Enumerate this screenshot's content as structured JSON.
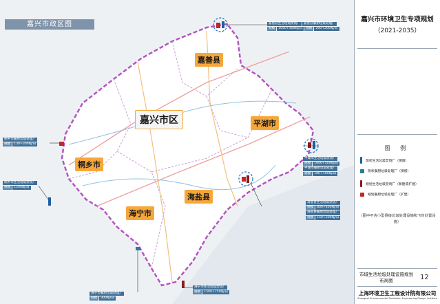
{
  "map": {
    "title": "嘉兴市政区图",
    "districts": [
      {
        "name": "嘉兴市区",
        "style": "big"
      },
      {
        "name": "嘉善县",
        "style": "normal"
      },
      {
        "name": "平湖市",
        "style": "normal"
      },
      {
        "name": "桐乡市",
        "style": "normal"
      },
      {
        "name": "海盐县",
        "style": "normal"
      },
      {
        "name": "海宁市",
        "style": "normal"
      }
    ],
    "callouts": [
      {
        "rows": [
          [
            "嘉善县生活垃圾焚烧厂",
            "嘉善县餐厨垃圾处理厂"
          ],
          [
            "规模",
            "1050+400吨/日",
            "规模",
            "200+200吨/日"
          ]
        ]
      },
      {
        "rows": [
          [
            "桐乡市餐厨垃圾处理厂"
          ],
          [
            "规模",
            "130+300吨/日"
          ]
        ]
      },
      {
        "rows": [
          [
            "桐乡市生活垃圾焚烧厂"
          ],
          [
            "规模",
            "1200吨/日"
          ]
        ]
      },
      {
        "rows": [
          [
            "平湖市生活垃圾焚烧厂"
          ],
          [
            "规模",
            "1000+500吨/日"
          ],
          [
            "平湖市餐厨垃圾处理厂"
          ],
          [
            "规模",
            "180+100吨/日"
          ]
        ]
      },
      {
        "rows": [
          [
            "海盐县生活垃圾焚烧厂"
          ],
          [
            "规模",
            "800+400吨/日"
          ],
          [
            "海盐县餐厨垃圾处理厂"
          ],
          [
            "规模",
            "150+200吨/日"
          ]
        ]
      },
      {
        "rows": [
          [
            "海宁市餐厨垃圾处理厂"
          ],
          [
            "规模",
            "300吨/日"
          ]
        ]
      },
      {
        "rows": [
          [
            "海宁市生活垃圾焚烧厂"
          ],
          [
            "规模",
            "1500+750吨/日"
          ]
        ]
      }
    ]
  },
  "side": {
    "title": "嘉兴市环境卫生专项规划",
    "subtitle": "（2021-2035）",
    "legend_title": "图 例",
    "legend": [
      {
        "label": "现状生活垃圾焚烧厂（保留）",
        "color": "#1f5fa3"
      },
      {
        "label": "现状餐厨垃圾处理厂（保留）",
        "color": "#2b7a9a"
      },
      {
        "label": "规划生活垃圾焚烧厂（新建或扩建）",
        "color": "#8d1b1b"
      },
      {
        "label": "规划餐厨垃圾处理厂（扩建）",
        "color": "#c0272d"
      }
    ],
    "note": "（图中不含小型县级垃圾处理设施和飞灰处置设施）",
    "sheet_title": "市域生活垃圾处理设施规划布局图",
    "page_number": "12",
    "company": "上海环境卫生工程设计院有限公司",
    "company_en": "Shanghai Environmental Sanitation Engineering Design Institute"
  }
}
